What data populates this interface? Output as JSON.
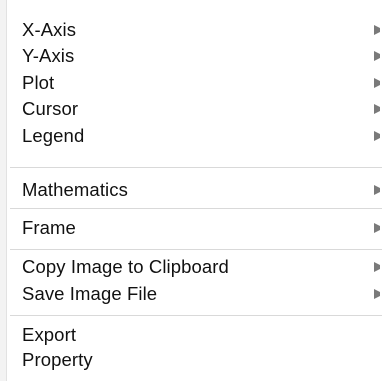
{
  "menu": {
    "items": [
      {
        "label": "X-Axis",
        "submenu": true
      },
      {
        "label": "Y-Axis",
        "submenu": true
      },
      {
        "label": "Plot",
        "submenu": true
      },
      {
        "label": "Cursor",
        "submenu": true
      },
      {
        "label": "Legend",
        "submenu": true
      },
      {
        "label": "Mathematics",
        "submenu": true
      },
      {
        "label": "Frame",
        "submenu": true
      },
      {
        "label": "Copy Image to Clipboard",
        "submenu": true
      },
      {
        "label": "Save Image File",
        "submenu": true
      },
      {
        "label": "Export",
        "submenu": false
      },
      {
        "label": "Property",
        "submenu": false
      }
    ],
    "submenu_arrow_icon": "chevron-right-icon",
    "colors": {
      "background": "#ffffff",
      "text": "#111111",
      "separator": "#d9d9d9"
    }
  }
}
